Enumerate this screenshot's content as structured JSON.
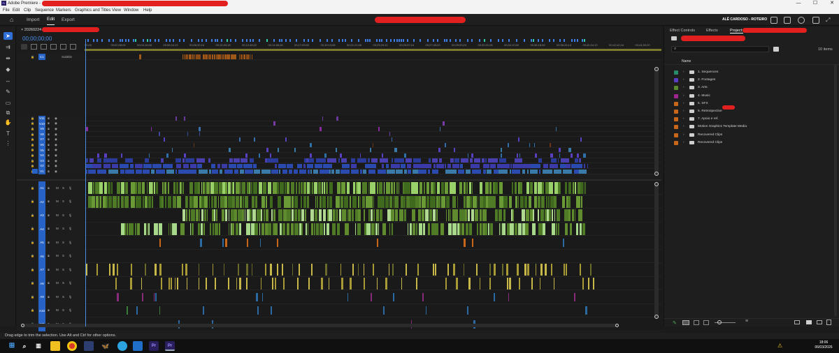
{
  "window": {
    "app_icon": "Pr",
    "title": "Adobe Premiere - ",
    "controls": [
      "—",
      "☐",
      "✕"
    ]
  },
  "menu": [
    "File",
    "Edit",
    "Clip",
    "Sequence",
    "Markers",
    "Graphics and Titles",
    "View",
    "Window",
    "Help"
  ],
  "header": {
    "tabs": [
      "Import",
      "Edit",
      "Export"
    ],
    "active_tab": "Edit",
    "user": "ALÊ CARDOSO - ROTEIRO"
  },
  "timeline": {
    "sequence_name": "20260224",
    "timecode": "00;00;00;00",
    "ruler_ticks": [
      "00;00",
      "00;02;08;04",
      "00;04;16;08",
      "00;06;24;12",
      "00;08;32;16",
      "00;10;40;18",
      "00;12;48;22",
      "00;14;56;26",
      "00;17;05;00",
      "00;19;13;06",
      "00;21;21;08",
      "00;23;29;12",
      "00;25;37;16",
      "00;27;45;20",
      "00;29;53;24",
      "00;32;01;28",
      "00;34;10;02",
      "00;36;18;06",
      "00;38;26;10",
      "00;40;34;12",
      "00;42;42;16",
      "00;44;50;20"
    ],
    "subtitle_track": {
      "label": "C1",
      "name": "Subtitle"
    },
    "video_tracks": [
      "V11",
      "V10",
      "V9",
      "V8",
      "V7",
      "V6",
      "V5",
      "V4",
      "V3",
      "V2",
      "V1"
    ],
    "audio_tracks": [
      "A1",
      "A2",
      "A3",
      "A4",
      "A5",
      "A6",
      "A7",
      "A8",
      "A9",
      "A10",
      "A11"
    ],
    "source_patch_video": "V1",
    "audio_flags": [
      "M",
      "S"
    ]
  },
  "project": {
    "tabs": [
      "Effect Controls",
      "Effects",
      "Project:"
    ],
    "active_tab": "Project:",
    "search_placeholder": "",
    "item_count": "10 items",
    "column_name": "Name",
    "bins": [
      {
        "name": "1. Sequences",
        "color": "#2a8a6a"
      },
      {
        "name": "2. Footages",
        "color": "#5b3cc4"
      },
      {
        "name": "3. Arts",
        "color": "#5b8a2a"
      },
      {
        "name": "4. Music",
        "color": "#a0258c"
      },
      {
        "name": "5. SFX",
        "color": "#c8661a"
      },
      {
        "name": "6. Retrospective",
        "color": "#c8661a"
      },
      {
        "name": "7. Apoio e ref.",
        "color": "#c8661a"
      },
      {
        "name": "Motion Graphics Template Media",
        "color": "#c8661a"
      },
      {
        "name": "Recovered Clips",
        "color": "#c8661a"
      },
      {
        "name": "Recovered Clips",
        "color": "#c8661a"
      }
    ]
  },
  "status_bar": {
    "message": "Drag edge to trim the selection. Use Alt and Ctrl for other options."
  },
  "taskbar": {
    "time": "18:06",
    "date": "06/03/2026",
    "apps": [
      "windows-start",
      "search",
      "task-view",
      "file-explorer",
      "chrome",
      "shield-app",
      "bluesky",
      "telegram",
      "photos",
      "premiere",
      "premiere"
    ]
  },
  "colors": {
    "accent_blue": "#2f6fd8",
    "timecode_blue": "#4a8eea",
    "audio_green": "#5f8a2e",
    "audio_yellow": "#c8b84a",
    "video_purple": "#5a3fc0",
    "video_blue": "#2f7fa8",
    "redaction": "#e32020"
  }
}
